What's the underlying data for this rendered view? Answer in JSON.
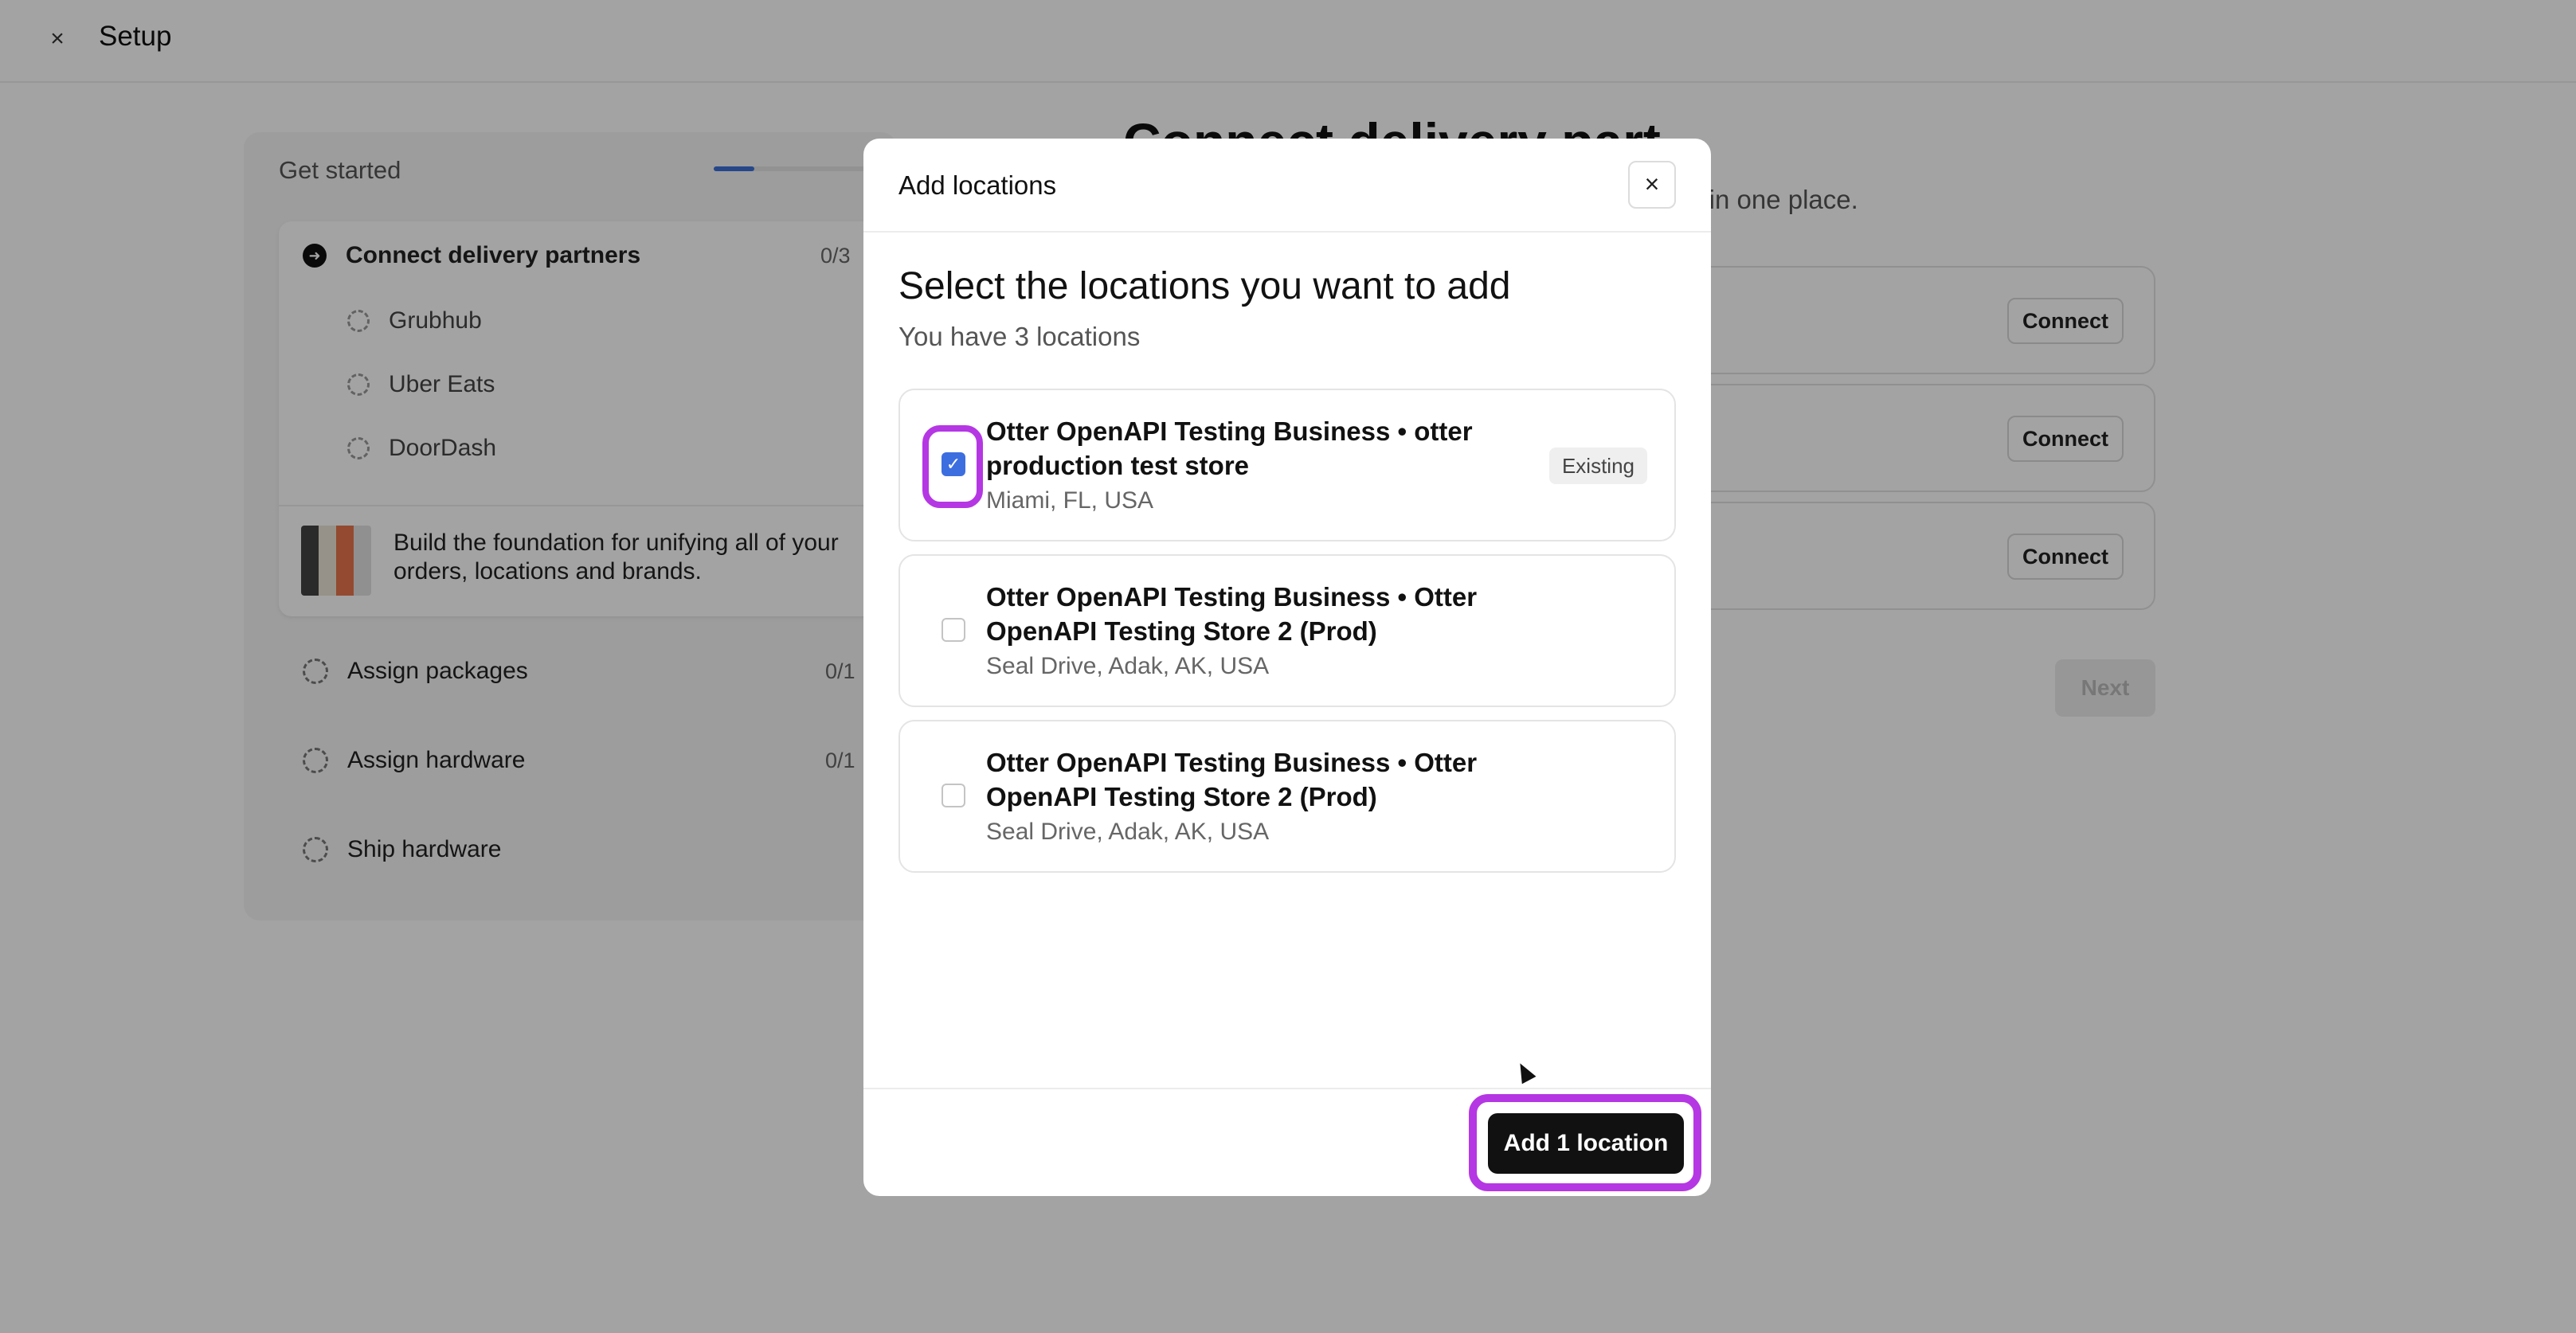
{
  "topbar": {
    "close_icon": "close-icon",
    "close_glyph": "×",
    "title": "Setup"
  },
  "sidebar": {
    "header": "Get started",
    "progress_fraction": 0.27,
    "steps": [
      {
        "label": "Connect delivery partners",
        "count": "0/3",
        "status": "current"
      },
      {
        "label": "Assign packages",
        "count": "0/1",
        "status": "pending"
      },
      {
        "label": "Assign hardware",
        "count": "0/1",
        "status": "pending"
      },
      {
        "label": "Ship hardware",
        "count": "",
        "status": "pending"
      }
    ],
    "sub_steps": [
      "Grubhub",
      "Uber Eats",
      "DoorDash"
    ],
    "promo_text": "Build the foundation for unifying all of your orders, locations and brands."
  },
  "main": {
    "heading_partial": "Connect delivery part",
    "subheading_partial": "s in one place.",
    "connect_label": "Connect",
    "next_label": "Next"
  },
  "modal": {
    "title": "Add locations",
    "close_glyph": "×",
    "heading": "Select the locations you want to add",
    "subheading": "You have 3 locations",
    "locations": [
      {
        "name": "Otter OpenAPI Testing Business • otter production test store",
        "address": "Miami, FL, USA",
        "checked": true,
        "badge": "Existing"
      },
      {
        "name": "Otter OpenAPI Testing Business • Otter OpenAPI Testing Store 2 (Prod)",
        "address": "Seal Drive, Adak, AK, USA",
        "checked": false,
        "badge": ""
      },
      {
        "name": "Otter OpenAPI Testing Business • Otter OpenAPI Testing Store 2 (Prod)",
        "address": "Seal Drive, Adak, AK, USA",
        "checked": false,
        "badge": ""
      }
    ],
    "checkmark_glyph": "✓",
    "submit_label": "Add 1 location"
  },
  "colors": {
    "highlight": "#b537e4",
    "checkbox_accent": "#3d6ee0",
    "primary_button": "#111111"
  }
}
